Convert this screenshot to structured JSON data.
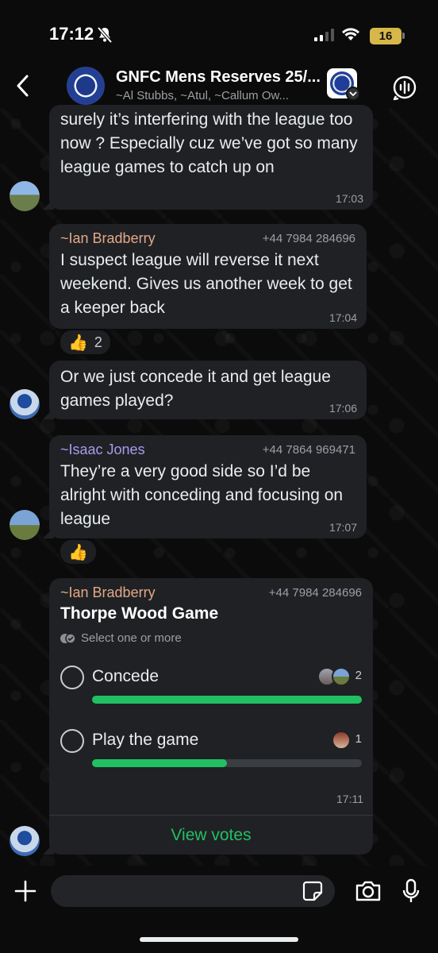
{
  "status_bar": {
    "time": "17:12",
    "battery": "16"
  },
  "header": {
    "title": "GNFC Mens Reserves 25/...",
    "subtitle": "~Al Stubbs, ~Atul, ~Callum Ow..."
  },
  "messages": [
    {
      "text": "surely it’s interfering with the league too now ? Especially cuz we’ve got so many league games to catch up on",
      "time": "17:03"
    },
    {
      "sender": "~Ian Bradberry",
      "phone": "+44 7984 284696",
      "text": "I suspect league will reverse it next weekend. Gives us another week to get a keeper back",
      "time": "17:04",
      "reaction": {
        "emoji": "👍",
        "count": "2"
      }
    },
    {
      "text": "Or we just concede it and get league games played?",
      "time": "17:06"
    },
    {
      "sender": "~Isaac Jones",
      "phone": "+44 7864 969471",
      "text": "They’re a very good side so I’d be alright with conceding and focusing on league",
      "time": "17:07",
      "reaction": {
        "emoji": "👍"
      }
    }
  ],
  "poll": {
    "sender": "~Ian Bradberry",
    "phone": "+44 7984 284696",
    "title": "Thorpe Wood Game",
    "hint": "Select one or more",
    "options": [
      {
        "label": "Concede",
        "votes": "2",
        "fraction": 1.0
      },
      {
        "label": "Play the game",
        "votes": "1",
        "fraction": 0.5
      }
    ],
    "time": "17:11",
    "view_votes": "View votes"
  },
  "colors": {
    "accent_green": "#21c063",
    "bubble": "#202124",
    "background": "#0b0b0b",
    "ian_name": "#e3a888",
    "isaac_name": "#a79bf0"
  },
  "icons": [
    "bell-slash-icon",
    "signal-icon",
    "wifi-icon",
    "back-chevron-icon",
    "voice-chat-icon",
    "plus-icon",
    "sticker-icon",
    "camera-icon",
    "microphone-icon",
    "double-check-icon",
    "thumbs-up-icon"
  ]
}
